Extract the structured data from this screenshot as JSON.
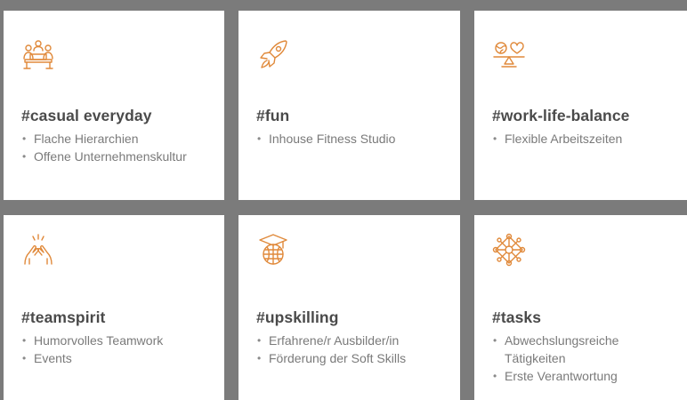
{
  "accent_color": "#e0893a",
  "cards": [
    {
      "icon": "meeting-people-icon",
      "title": "#casual everyday",
      "items": [
        "Flache Hierarchien",
        "Offene Unternehmenskultur"
      ]
    },
    {
      "icon": "rocket-icon",
      "title": "#fun",
      "items": [
        "Inhouse Fitness Studio"
      ]
    },
    {
      "icon": "balance-scale-icon",
      "title": "#work-life-balance",
      "items": [
        "Flexible Arbeitszeiten"
      ]
    },
    {
      "icon": "high-five-icon",
      "title": "#teamspirit",
      "items": [
        "Humorvolles Teamwork",
        "Events"
      ]
    },
    {
      "icon": "graduation-globe-icon",
      "title": "#upskilling",
      "items": [
        "Erfahrene/r Ausbilder/in",
        "Förderung der Soft Skills"
      ]
    },
    {
      "icon": "network-icon",
      "title": "#tasks",
      "items": [
        "Abwechslungsreiche Tätigkeiten",
        "Erste Verantwortung"
      ]
    }
  ]
}
